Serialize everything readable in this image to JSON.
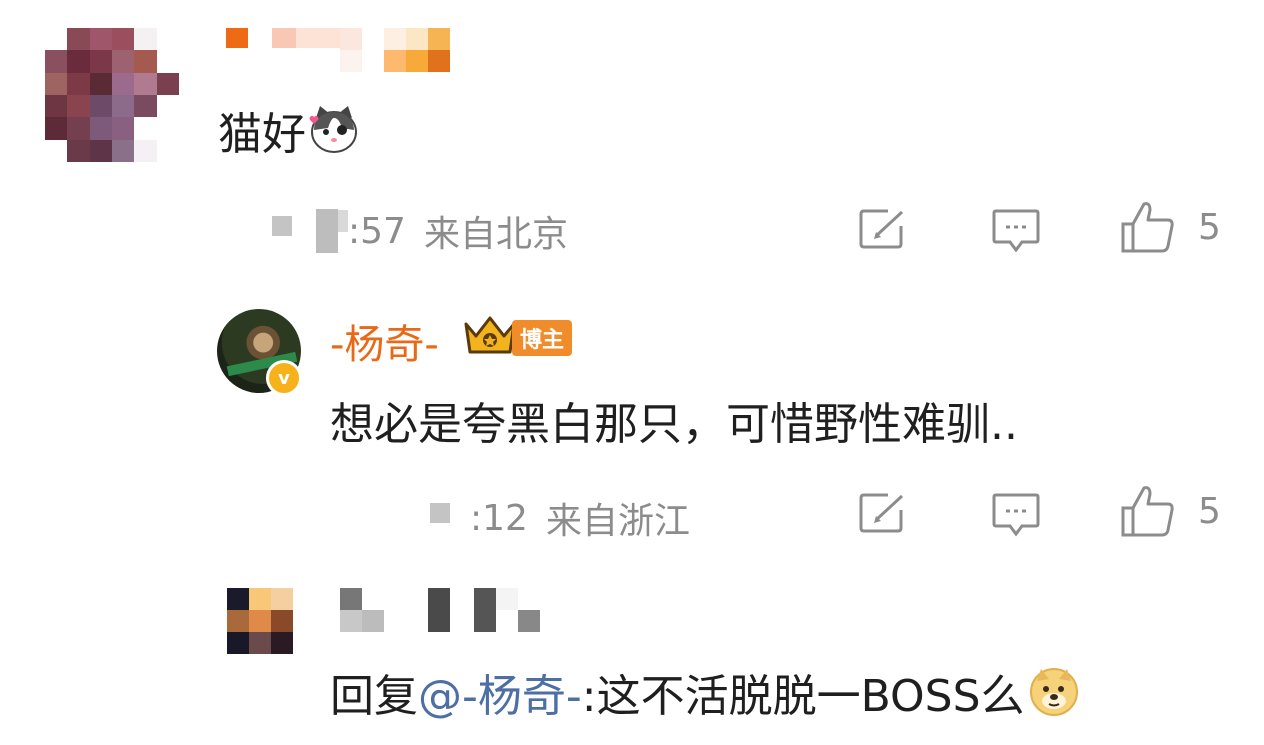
{
  "comment1": {
    "text": "猫好",
    "emoji_icon": "cat-face-icon",
    "time_suffix": ":57",
    "location": "来自北京",
    "like_count": "5"
  },
  "reply1": {
    "author": "-杨奇-",
    "badge": "博主",
    "verified_mark": "v",
    "text": "想必是夸黑白那只，可惜野性难驯..",
    "time_suffix": ":12",
    "location": "来自浙江",
    "like_count": "5"
  },
  "reply2": {
    "prefix": "回复",
    "mention": "@-杨奇-",
    "text": ":这不活脱脱一BOSS么",
    "emoji_icon": "doge-icon"
  },
  "icons": {
    "repost": "repost-icon",
    "comment": "comment-icon",
    "like": "thumbs-up-icon"
  },
  "colors": {
    "name_orange": "#e86a17",
    "mention_blue": "#4d6fa3",
    "meta_gray": "#8c8c8c",
    "badge_orange": "#f08c2a"
  }
}
